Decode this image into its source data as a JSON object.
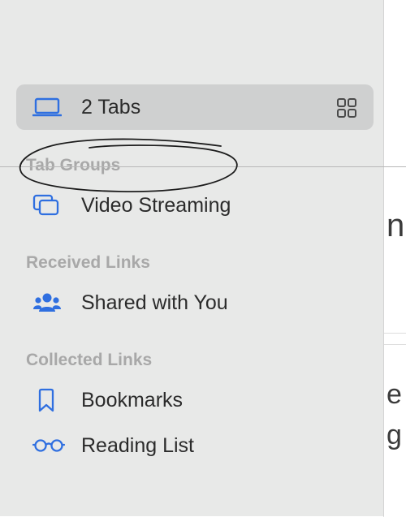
{
  "background": {
    "fragments": [
      "n",
      "e",
      "g"
    ]
  },
  "sidebar": {
    "tabs_row": {
      "label": "2 Tabs",
      "icon": "laptop-icon",
      "trailing_icon": "grid-icon"
    },
    "sections": [
      {
        "header": "Tab Groups",
        "items": [
          {
            "label": "Video Streaming",
            "icon": "tab-group-icon"
          }
        ]
      },
      {
        "header": "Received Links",
        "items": [
          {
            "label": "Shared with You",
            "icon": "shared-people-icon"
          }
        ]
      },
      {
        "header": "Collected Links",
        "items": [
          {
            "label": "Bookmarks",
            "icon": "bookmark-icon"
          },
          {
            "label": "Reading List",
            "icon": "glasses-icon"
          }
        ]
      }
    ]
  },
  "colors": {
    "accent": "#2f6fe0",
    "sidebar_bg": "#e8e9e8",
    "selected_bg": "#cfd0d0",
    "section_header": "#a8a8a8"
  }
}
